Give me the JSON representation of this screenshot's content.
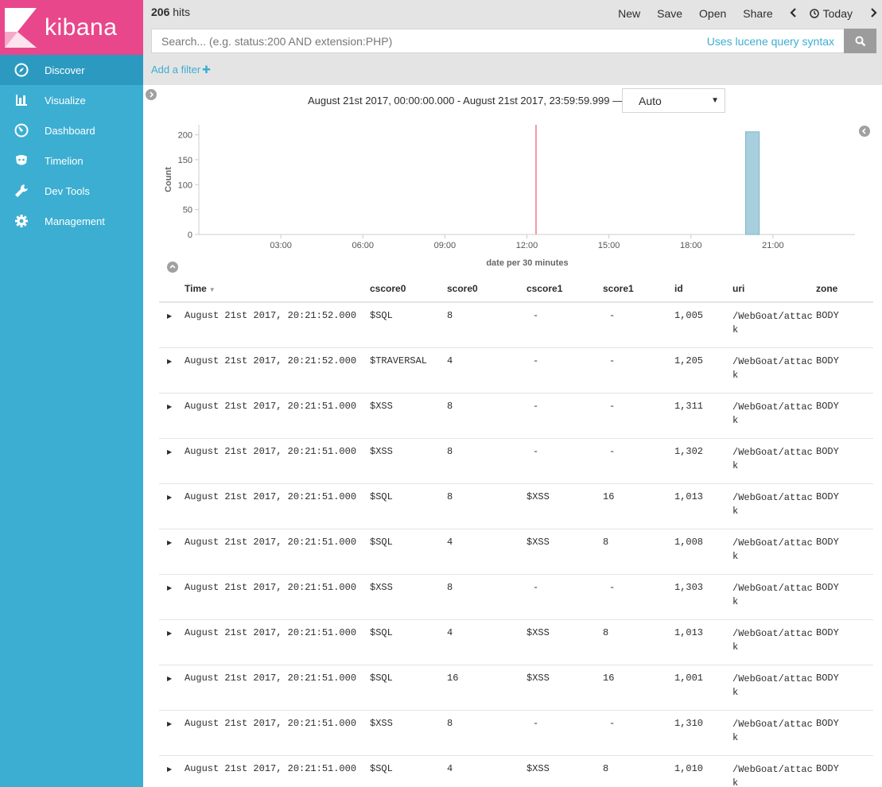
{
  "app": {
    "logo_text": "kibana"
  },
  "sidebar": {
    "items": [
      {
        "label": "Discover",
        "icon": "compass-icon",
        "active": true
      },
      {
        "label": "Visualize",
        "icon": "bar-chart-icon",
        "active": false
      },
      {
        "label": "Dashboard",
        "icon": "dashboard-icon",
        "active": false
      },
      {
        "label": "Timelion",
        "icon": "timelion-icon",
        "active": false
      },
      {
        "label": "Dev Tools",
        "icon": "wrench-icon",
        "active": false
      },
      {
        "label": "Management",
        "icon": "gear-icon",
        "active": false
      }
    ]
  },
  "topbar": {
    "hits_count": "206",
    "hits_label": "hits",
    "menu": {
      "new": "New",
      "save": "Save",
      "open": "Open",
      "share": "Share",
      "today": "Today"
    }
  },
  "search": {
    "placeholder": "Search... (e.g. status:200 AND extension:PHP)",
    "syntax_link": "Uses lucene query syntax"
  },
  "filter": {
    "add_label": "Add a filter"
  },
  "timerange": {
    "text": "August 21st 2017, 00:00:00.000 - August 21st 2017, 23:59:59.999 —",
    "interval": "Auto"
  },
  "chart_data": {
    "type": "bar",
    "ylabel": "Count",
    "xlabel": "date per 30 minutes",
    "y_ticks": [
      "0",
      "50",
      "100",
      "150",
      "200"
    ],
    "x_ticks": [
      "03:00",
      "06:00",
      "09:00",
      "12:00",
      "15:00",
      "18:00",
      "21:00"
    ],
    "ylim": [
      0,
      220
    ],
    "bars": [
      {
        "x": "20:00",
        "value": 206
      }
    ],
    "current_time_marker": "12:20",
    "bar_color": "#a8cfdd",
    "marker_color": "#f19ba8"
  },
  "table": {
    "columns": [
      "Time",
      "cscore0",
      "score0",
      "cscore1",
      "score1",
      "id",
      "uri",
      "zone"
    ],
    "rows": [
      [
        "August 21st 2017, 20:21:52.000",
        "$SQL",
        "8",
        "-",
        "-",
        "1,005",
        "/WebGoat/attack",
        "BODY"
      ],
      [
        "August 21st 2017, 20:21:52.000",
        "$TRAVERSAL",
        "4",
        "-",
        "-",
        "1,205",
        "/WebGoat/attack",
        "BODY"
      ],
      [
        "August 21st 2017, 20:21:51.000",
        "$XSS",
        "8",
        "-",
        "-",
        "1,311",
        "/WebGoat/attack",
        "BODY"
      ],
      [
        "August 21st 2017, 20:21:51.000",
        "$XSS",
        "8",
        "-",
        "-",
        "1,302",
        "/WebGoat/attack",
        "BODY"
      ],
      [
        "August 21st 2017, 20:21:51.000",
        "$SQL",
        "8",
        "$XSS",
        "16",
        "1,013",
        "/WebGoat/attack",
        "BODY"
      ],
      [
        "August 21st 2017, 20:21:51.000",
        "$SQL",
        "4",
        "$XSS",
        "8",
        "1,008",
        "/WebGoat/attack",
        "BODY"
      ],
      [
        "August 21st 2017, 20:21:51.000",
        "$XSS",
        "8",
        "-",
        "-",
        "1,303",
        "/WebGoat/attack",
        "BODY"
      ],
      [
        "August 21st 2017, 20:21:51.000",
        "$SQL",
        "4",
        "$XSS",
        "8",
        "1,013",
        "/WebGoat/attack",
        "BODY"
      ],
      [
        "August 21st 2017, 20:21:51.000",
        "$SQL",
        "16",
        "$XSS",
        "16",
        "1,001",
        "/WebGoat/attack",
        "BODY"
      ],
      [
        "August 21st 2017, 20:21:51.000",
        "$XSS",
        "8",
        "-",
        "-",
        "1,310",
        "/WebGoat/attack",
        "BODY"
      ],
      [
        "August 21st 2017, 20:21:51.000",
        "$SQL",
        "4",
        "$XSS",
        "8",
        "1,010",
        "/WebGoat/attack",
        "BODY"
      ]
    ]
  }
}
